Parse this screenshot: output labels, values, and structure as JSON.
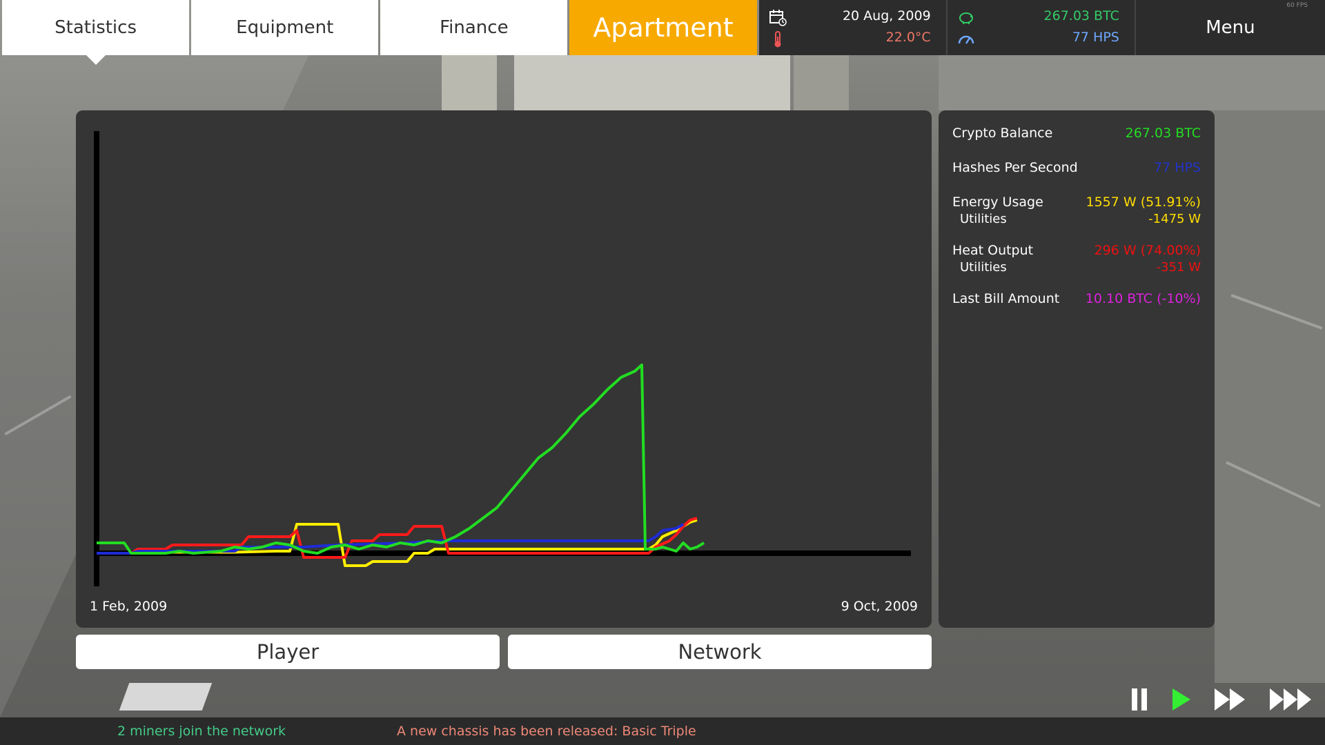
{
  "nav": {
    "tabs": [
      {
        "label": "Statistics"
      },
      {
        "label": "Equipment"
      },
      {
        "label": "Finance"
      },
      {
        "label": "Apartment"
      }
    ],
    "menu_label": "Menu",
    "fps": "60 FPS"
  },
  "status": {
    "date": "20 Aug, 2009",
    "temperature": "22.0°C",
    "balance": "267.03 BTC",
    "hashrate": "77 HPS"
  },
  "chart_data": {
    "type": "line",
    "x_start_label": "1 Feb, 2009",
    "x_end_label": "9 Oct, 2009",
    "series": [
      {
        "color": "#ffee00",
        "points": [
          [
            0,
            0
          ],
          [
            5,
            0
          ],
          [
            8,
            0.5
          ],
          [
            20,
            0.5
          ],
          [
            26,
            1
          ],
          [
            28,
            1
          ],
          [
            29,
            14
          ],
          [
            35,
            14
          ],
          [
            36,
            -6
          ],
          [
            39,
            -6
          ],
          [
            40,
            -4
          ],
          [
            45,
            -4
          ],
          [
            46,
            0
          ],
          [
            48,
            0
          ],
          [
            49,
            2
          ],
          [
            80,
            2
          ],
          [
            81,
            4
          ],
          [
            82,
            8
          ],
          [
            84,
            11
          ],
          [
            86,
            15
          ],
          [
            87,
            16
          ]
        ]
      },
      {
        "color": "#ff1a1a",
        "points": [
          [
            0,
            0
          ],
          [
            5,
            0
          ],
          [
            6,
            2
          ],
          [
            10,
            2
          ],
          [
            11,
            4
          ],
          [
            21,
            4
          ],
          [
            22,
            8
          ],
          [
            28,
            8
          ],
          [
            29,
            11
          ],
          [
            30,
            -2
          ],
          [
            36,
            -2
          ],
          [
            37,
            6
          ],
          [
            40,
            6
          ],
          [
            41,
            9
          ],
          [
            45,
            9
          ],
          [
            46,
            13
          ],
          [
            50,
            13
          ],
          [
            51,
            0
          ],
          [
            80,
            0
          ],
          [
            81,
            3
          ],
          [
            83,
            6
          ],
          [
            84,
            9
          ],
          [
            85,
            13
          ],
          [
            86,
            16
          ],
          [
            87,
            17
          ]
        ]
      },
      {
        "color": "#1e2bd6",
        "points": [
          [
            0,
            0
          ],
          [
            5,
            0
          ],
          [
            6,
            1
          ],
          [
            20,
            1
          ],
          [
            21,
            3
          ],
          [
            30,
            3
          ],
          [
            35,
            4
          ],
          [
            45,
            5
          ],
          [
            50,
            6
          ],
          [
            80,
            6
          ],
          [
            81,
            8
          ],
          [
            82,
            11
          ],
          [
            84,
            12
          ],
          [
            85,
            14
          ]
        ]
      },
      {
        "color": "#22dd22",
        "points": [
          [
            0,
            5
          ],
          [
            4,
            5
          ],
          [
            5,
            0
          ],
          [
            10,
            0
          ],
          [
            12,
            1
          ],
          [
            14,
            0
          ],
          [
            18,
            1
          ],
          [
            20,
            3
          ],
          [
            22,
            2
          ],
          [
            24,
            3
          ],
          [
            26,
            5
          ],
          [
            28,
            4
          ],
          [
            30,
            1
          ],
          [
            32,
            0
          ],
          [
            34,
            3
          ],
          [
            36,
            4
          ],
          [
            38,
            2
          ],
          [
            40,
            4
          ],
          [
            42,
            3
          ],
          [
            44,
            5
          ],
          [
            46,
            4
          ],
          [
            48,
            6
          ],
          [
            50,
            5
          ],
          [
            52,
            8
          ],
          [
            54,
            12
          ],
          [
            56,
            17
          ],
          [
            58,
            22
          ],
          [
            60,
            30
          ],
          [
            62,
            38
          ],
          [
            64,
            46
          ],
          [
            66,
            51
          ],
          [
            68,
            58
          ],
          [
            70,
            66
          ],
          [
            72,
            72
          ],
          [
            74,
            79
          ],
          [
            76,
            85
          ],
          [
            78,
            88
          ],
          [
            79,
            91
          ],
          [
            79.5,
            2
          ],
          [
            81,
            2
          ],
          [
            82,
            3
          ],
          [
            84,
            1
          ],
          [
            85,
            5
          ],
          [
            86,
            2
          ],
          [
            87,
            3
          ],
          [
            88,
            5
          ]
        ]
      }
    ]
  },
  "toggles": {
    "player_label": "Player",
    "network_label": "Network"
  },
  "stats": {
    "crypto_balance": {
      "label": "Crypto Balance",
      "value": "267.03 BTC",
      "color": "#22dd22"
    },
    "hashes_per_second": {
      "label": "Hashes Per Second",
      "value": "77 HPS",
      "color": "#2233cc"
    },
    "energy_usage": {
      "label": "Energy Usage",
      "value": "1557 W (51.91%)",
      "color": "#ffdd00",
      "sub_label": "Utilities",
      "sub_value": "-1475 W"
    },
    "heat_output": {
      "label": "Heat Output",
      "value": "296 W (74.00%)",
      "color": "#ee1111",
      "sub_label": "Utilities",
      "sub_value": "-351 W"
    },
    "last_bill": {
      "label": "Last Bill Amount",
      "value": "10.10 BTC (-10%)",
      "color": "#dd22dd"
    }
  },
  "ticker": {
    "left_message": "2 miners join the network",
    "right_message": "A new chassis has been released: Basic Triple",
    "left_color": "#44cc88",
    "right_color": "#ee8877"
  },
  "icons": {
    "calendar": "calendar-icon",
    "thermometer": "thermometer-icon",
    "piggy_bank": "piggy-bank-icon",
    "speedometer": "speedometer-icon",
    "pause": "pause-icon",
    "play": "play-icon",
    "fast_forward": "fast-forward-icon",
    "fastest_forward": "fastest-forward-icon"
  }
}
